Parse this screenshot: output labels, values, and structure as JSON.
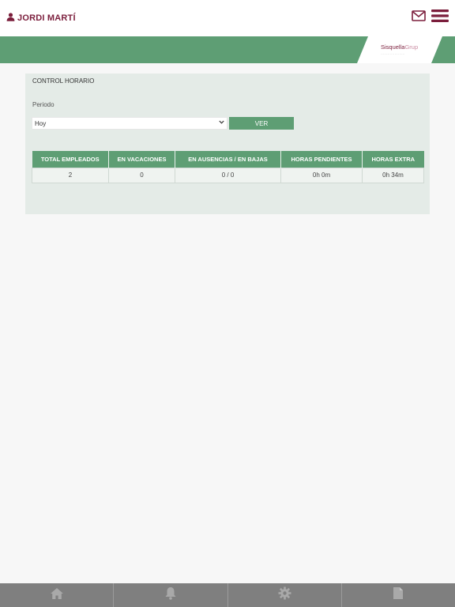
{
  "header": {
    "user_name": "JORDI MARTÍ",
    "user_icon": "user-icon",
    "mail_icon": "envelope-icon",
    "menu_icon": "hamburger-menu-icon",
    "accent_color": "#7b1e3c"
  },
  "logo": {
    "brand_main": "Sisquella",
    "brand_suffix": "Grup",
    "tagline": "·····················"
  },
  "brand_green": "#5e9e74",
  "control": {
    "title": "CONTROL HORARIO",
    "period_label": "Periodo",
    "period_value": "Hoy",
    "view_button": "VER"
  },
  "summary_table": {
    "headers": [
      "TOTAL EMPLEADOS",
      "EN VACACIONES",
      "EN AUSENCIAS / EN BAJAS",
      "HORAS PENDIENTES",
      "HORAS EXTRA"
    ],
    "rows": [
      [
        "2",
        "0",
        "0 / 0",
        "0h 0m",
        "0h 34m"
      ]
    ]
  },
  "bottom_nav": [
    {
      "icon": "home-icon"
    },
    {
      "icon": "bell-icon"
    },
    {
      "icon": "gear-icon"
    },
    {
      "icon": "document-icon"
    }
  ]
}
